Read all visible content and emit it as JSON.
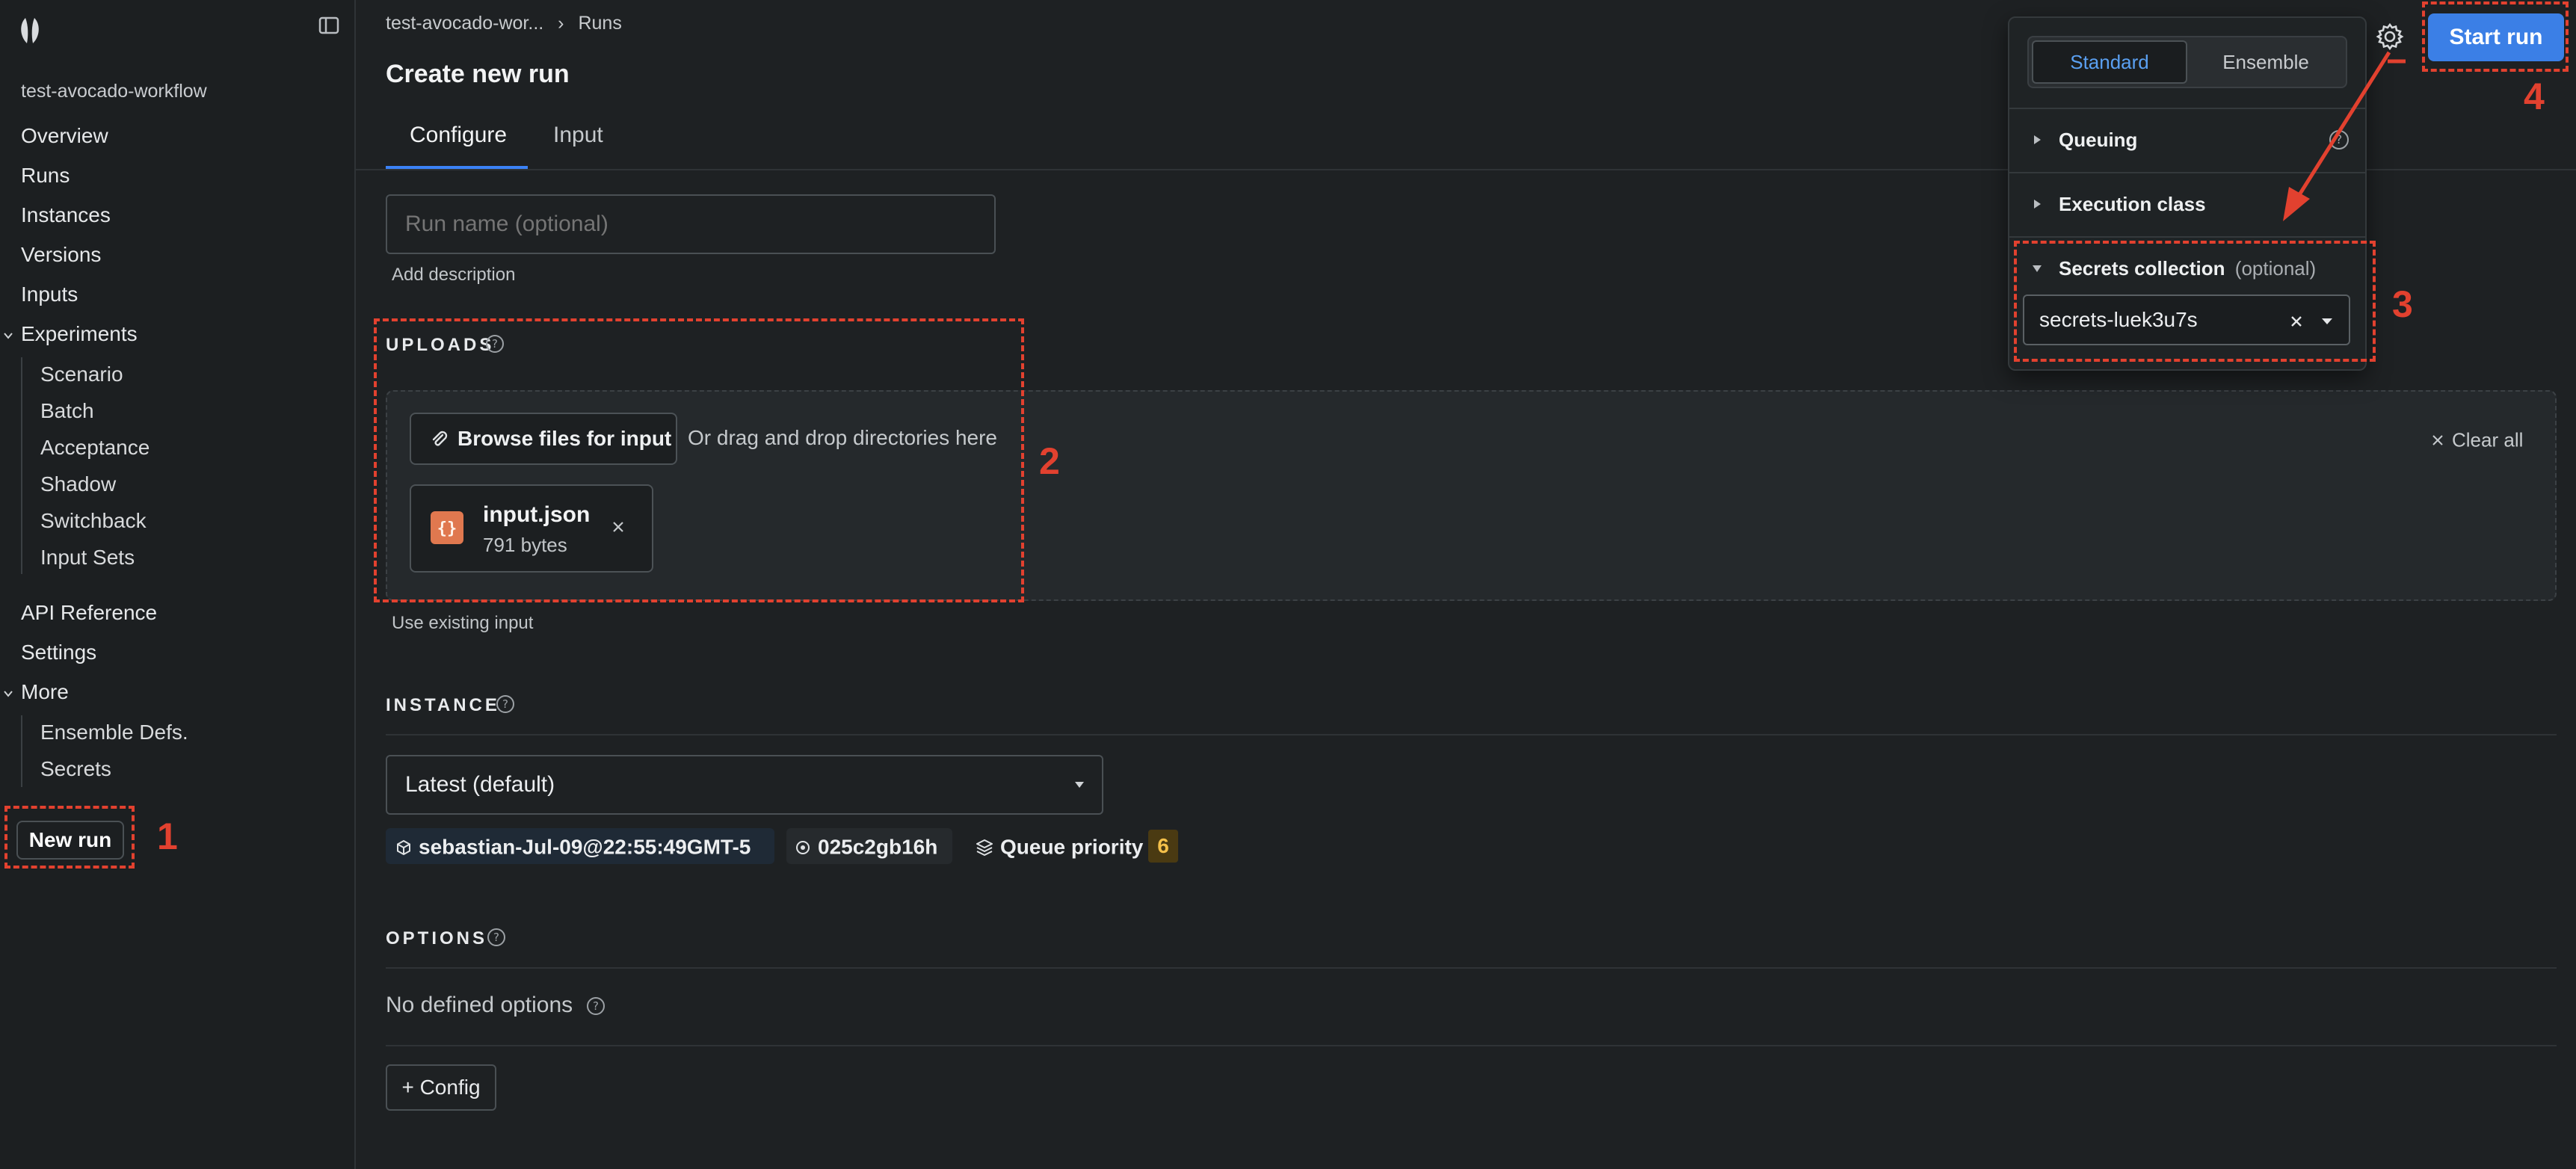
{
  "sidebar": {
    "workspace": "test-avocado-workflow",
    "items": [
      {
        "label": "Overview"
      },
      {
        "label": "Runs"
      },
      {
        "label": "Instances"
      },
      {
        "label": "Versions"
      },
      {
        "label": "Inputs"
      }
    ],
    "experiments": {
      "label": "Experiments",
      "children": [
        {
          "label": "Scenario"
        },
        {
          "label": "Batch"
        },
        {
          "label": "Acceptance"
        },
        {
          "label": "Shadow"
        },
        {
          "label": "Switchback"
        },
        {
          "label": "Input Sets"
        }
      ]
    },
    "api_reference": "API Reference",
    "settings": "Settings",
    "more": {
      "label": "More",
      "children": [
        {
          "label": "Ensemble Defs."
        },
        {
          "label": "Secrets"
        }
      ]
    },
    "new_run": "New run"
  },
  "breadcrumb": {
    "workflow": "test-avocado-wor...",
    "separator": "›",
    "current": "Runs"
  },
  "page": {
    "title": "Create new run",
    "tabs": [
      {
        "label": "Configure",
        "active": true
      },
      {
        "label": "Input",
        "active": false
      }
    ]
  },
  "form": {
    "run_name_placeholder": "Run name (optional)",
    "add_description": "Add description",
    "uploads": {
      "heading": "UPLOADS",
      "browse_label": "Browse files for input",
      "drag_text": "Or drag and drop directories here",
      "clear_all": "Clear all",
      "file": {
        "name": "input.json",
        "size": "791 bytes"
      },
      "use_existing": "Use existing input"
    },
    "instance": {
      "heading": "INSTANCE",
      "selected": "Latest (default)",
      "version": "sebastian-Jul-09@22:55:49GMT-5",
      "hash": "025c2gb16h",
      "queue_priority_label": "Queue priority",
      "queue_priority_value": "6"
    },
    "options": {
      "heading": "OPTIONS",
      "empty_text": "No defined options",
      "add_config": "+ Config"
    }
  },
  "popover": {
    "modes": [
      {
        "label": "Standard",
        "selected": true
      },
      {
        "label": "Ensemble",
        "selected": false
      }
    ],
    "queuing": "Queuing",
    "execution_class": "Execution class",
    "secrets": {
      "label": "Secrets collection",
      "optional": "(optional)",
      "value": "secrets-luek3u7s"
    }
  },
  "header_actions": {
    "start_run": "Start run"
  },
  "annotations": [
    "1",
    "2",
    "3",
    "4"
  ],
  "colors": {
    "accent": "#3b82f6",
    "annotation": "#e2412f",
    "background": "#1e2123"
  }
}
